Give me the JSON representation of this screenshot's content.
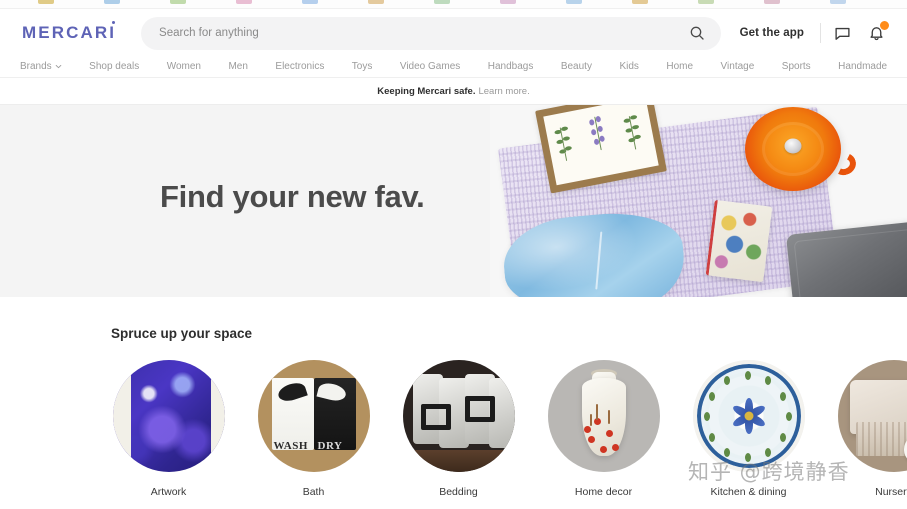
{
  "browser": {
    "tab_colors": [
      "#c9a227",
      "#6ea8d8",
      "#8fbf6a",
      "#d98ab0",
      "#7aa9e0",
      "#d0a050",
      "#8bbf8b",
      "#c98fbb",
      "#7fb0dd",
      "#cfa040",
      "#9dbf7a",
      "#c98fa8",
      "#8fb6e0"
    ]
  },
  "header": {
    "logo": "MERCARI",
    "search": {
      "placeholder": "Search for anything",
      "value": "",
      "icon": "search-icon"
    },
    "get_app_label": "Get the app",
    "messages_icon": "message-icon",
    "notifications_icon": "bell-icon",
    "notification_badge_color": "#FF8C1A"
  },
  "nav": {
    "items": [
      {
        "label": "Brands",
        "has_chevron": true
      },
      {
        "label": "Shop deals",
        "has_chevron": false
      },
      {
        "label": "Women",
        "has_chevron": false
      },
      {
        "label": "Men",
        "has_chevron": false
      },
      {
        "label": "Electronics",
        "has_chevron": false
      },
      {
        "label": "Toys",
        "has_chevron": false
      },
      {
        "label": "Video Games",
        "has_chevron": false
      },
      {
        "label": "Handbags",
        "has_chevron": false
      },
      {
        "label": "Beauty",
        "has_chevron": false
      },
      {
        "label": "Kids",
        "has_chevron": false
      },
      {
        "label": "Home",
        "has_chevron": false
      },
      {
        "label": "Vintage",
        "has_chevron": false
      },
      {
        "label": "Sports",
        "has_chevron": false
      },
      {
        "label": "Handmade",
        "has_chevron": false
      }
    ]
  },
  "safety_banner": {
    "strong_text": "Keeping Mercari safe.",
    "link_text": "Learn more."
  },
  "hero": {
    "title": "Find your new fav.",
    "background_color": "#f4f4f4",
    "title_color": "#4b4b4b",
    "image_items": [
      "framed-botanical-art",
      "lavender-knit-blanket",
      "orange-dutch-oven",
      "blue-fleece-jacket",
      "video-game-case",
      "gray-laptop-sleeve"
    ]
  },
  "categories": {
    "title": "Spruce up your space",
    "items": [
      {
        "label": "Artwork",
        "art": "artwork"
      },
      {
        "label": "Bath",
        "art": "bath",
        "towel_left_text": "WASH",
        "towel_right_text": "DRY"
      },
      {
        "label": "Bedding",
        "art": "bedding"
      },
      {
        "label": "Home decor",
        "art": "decor"
      },
      {
        "label": "Kitchen & dining",
        "art": "kitchen"
      },
      {
        "label": "Nursery",
        "art": "nursery"
      }
    ]
  },
  "watermark": {
    "text": "知乎 @跨境静香"
  }
}
